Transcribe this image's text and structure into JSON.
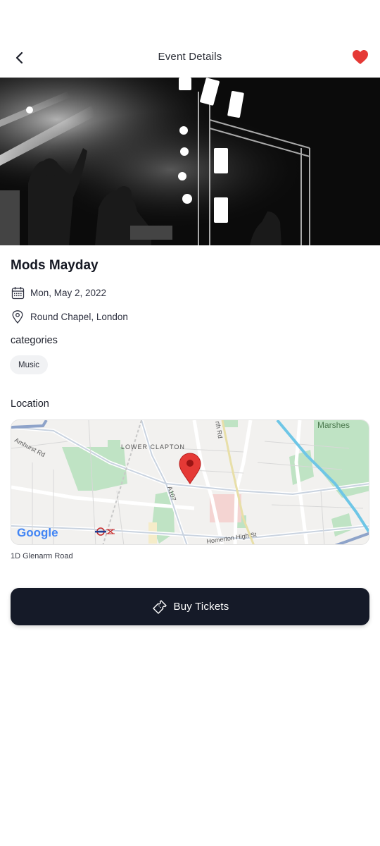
{
  "header": {
    "title": "Event Details",
    "back_icon": "chevron-left-icon",
    "favorite_icon": "heart-icon",
    "favorite_color": "#e53935",
    "favorited": true
  },
  "hero": {
    "image_icon": "concert-photo"
  },
  "event": {
    "title": "Mods Mayday",
    "date": "Mon, May 2, 2022",
    "date_icon": "calendar-icon",
    "venue": "Round Chapel, London",
    "venue_icon": "location-pin-icon"
  },
  "categories": {
    "label": "categories",
    "items": [
      "Music"
    ]
  },
  "location": {
    "label": "Location",
    "address": "1D Glenarm Road",
    "map": {
      "labels": {
        "marshes": "Marshes",
        "lower_clapton": "LOWER CLAPTON",
        "amhurst_rd": "Amhurst Rd",
        "a107": "A107",
        "homerton_high_st": "Homerton High St",
        "north_rd": "rth Rd",
        "google": "Google"
      },
      "marker_color": "#e53935"
    }
  },
  "actions": {
    "buy_label": "Buy Tickets",
    "buy_icon": "ticket-icon",
    "buy_bg": "#151a28"
  }
}
